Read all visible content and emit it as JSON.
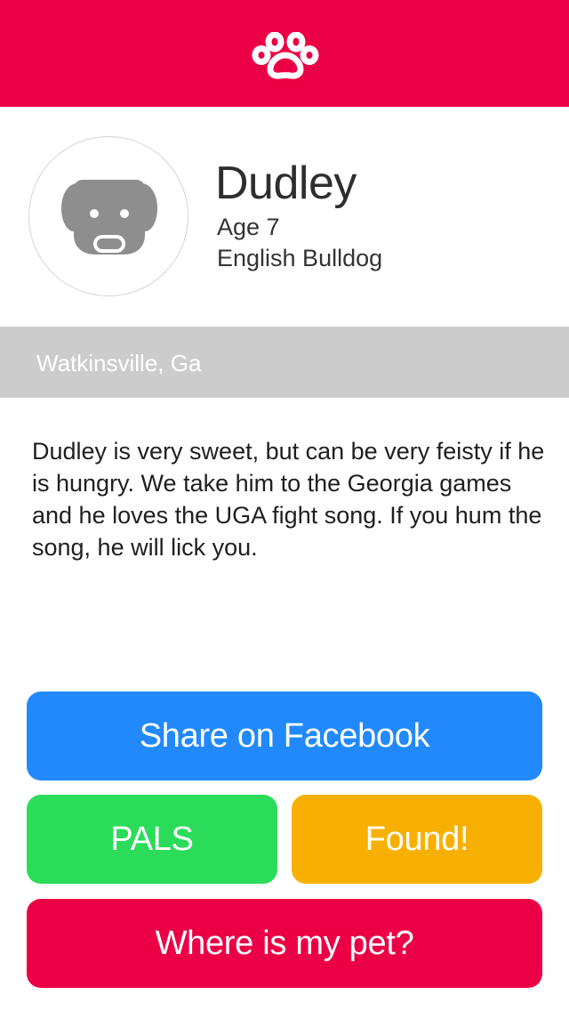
{
  "header": {
    "logo_icon": "paw-icon",
    "background_color": "#ec0045"
  },
  "profile": {
    "avatar_icon": "dog-face-icon",
    "name": "Dudley",
    "age": "Age 7",
    "breed": "English Bulldog"
  },
  "location": {
    "text": "Watkinsville, Ga"
  },
  "description": {
    "text": "Dudley is very sweet, but can be very feisty if he is hungry. We take him to the Georgia games and he loves the UGA fight song. If you hum the song, he will lick you."
  },
  "buttons": {
    "facebook_label": "Share on Facebook",
    "facebook_color": "#2189fc",
    "pals_label": "PALS",
    "pals_color": "#2bdc5a",
    "found_label": "Found!",
    "found_color": "#f8b000",
    "where_label": "Where is my pet?",
    "where_color": "#ec0045"
  }
}
